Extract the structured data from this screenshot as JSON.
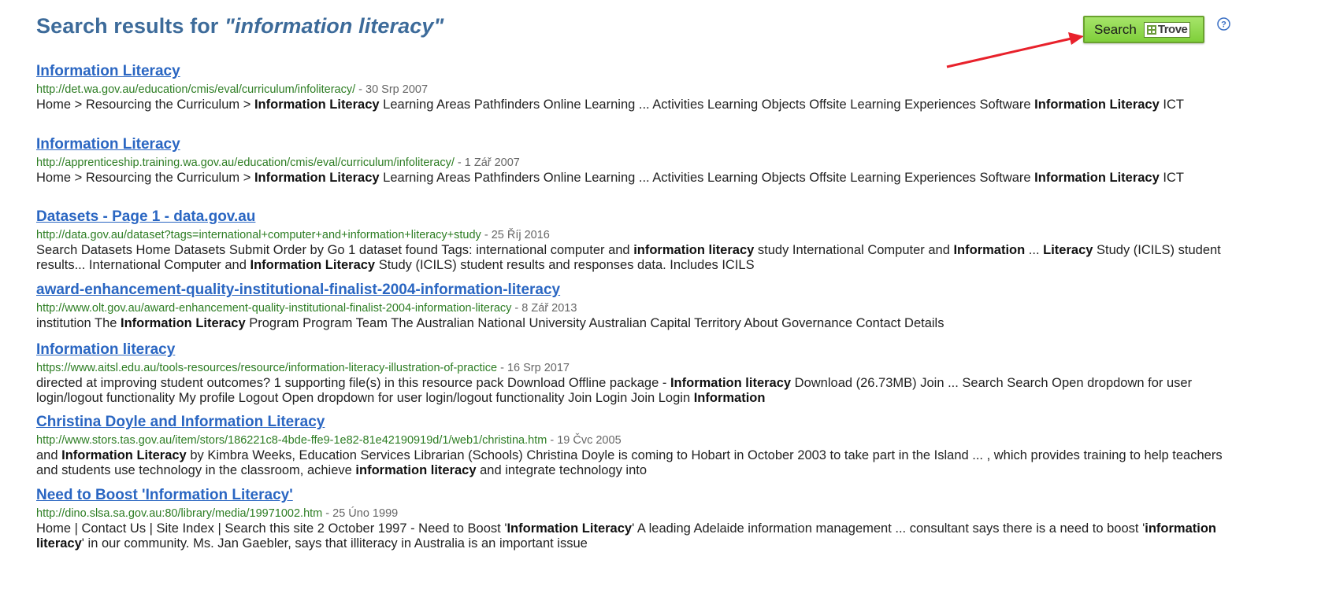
{
  "header": {
    "prefix": "Search results for ",
    "query": "\"information literacy\""
  },
  "trove_button": {
    "label": "Search",
    "logo_text": "Trove"
  },
  "help_icon": "question-circle-icon",
  "colors": {
    "title_blue": "#3d6b9a",
    "link_blue": "#2a66c2",
    "url_green": "#2d7d23",
    "button_green": "#8fd94a",
    "arrow_red": "#e8212b"
  },
  "results": [
    {
      "title": "Information Literacy",
      "url": "http://det.wa.gov.au/education/cmis/eval/curriculum/infoliteracy/",
      "date": " - 30 Srp 2007",
      "snippet": [
        {
          "t": "Home > Resourcing the Curriculum > ",
          "b": false
        },
        {
          "t": "Information Literacy",
          "b": true
        },
        {
          "t": " Learning Areas Pathfinders Online Learning ... Activities Learning Objects Offsite Learning Experiences Software ",
          "b": false
        },
        {
          "t": "Information Literacy",
          "b": true
        },
        {
          "t": " ICT",
          "b": false
        }
      ]
    },
    {
      "title": "Information Literacy",
      "url": "http://apprenticeship.training.wa.gov.au/education/cmis/eval/curriculum/infoliteracy/",
      "date": " - 1 Zář 2007",
      "snippet": [
        {
          "t": "Home > Resourcing the Curriculum > ",
          "b": false
        },
        {
          "t": "Information Literacy",
          "b": true
        },
        {
          "t": " Learning Areas Pathfinders Online Learning ... Activities Learning Objects Offsite Learning Experiences Software ",
          "b": false
        },
        {
          "t": "Information Literacy",
          "b": true
        },
        {
          "t": " ICT",
          "b": false
        }
      ]
    },
    {
      "title": "Datasets - Page 1 - data.gov.au",
      "url": "http://data.gov.au/dataset?tags=international+computer+and+information+literacy+study",
      "date": " - 25 Říj 2016",
      "snippet": [
        {
          "t": "Search Datasets Home Datasets Submit Order by Go 1 dataset found Tags: international computer and ",
          "b": false
        },
        {
          "t": "information literacy",
          "b": true
        },
        {
          "t": " study International Computer and ",
          "b": false
        },
        {
          "t": "Information",
          "b": true
        },
        {
          "t": " ... ",
          "b": false
        },
        {
          "t": "Literacy",
          "b": true
        },
        {
          "t": " Study (ICILS) student results... International Computer and ",
          "b": false
        },
        {
          "t": "Information Literacy",
          "b": true
        },
        {
          "t": " Study (ICILS) student results and responses data. Includes ICILS",
          "b": false
        }
      ]
    },
    {
      "title": "award-enhancement-quality-institutional-finalist-2004-information-literacy",
      "url": "http://www.olt.gov.au/award-enhancement-quality-institutional-finalist-2004-information-literacy",
      "date": " - 8 Zář 2013",
      "snippet": [
        {
          "t": "institution The ",
          "b": false
        },
        {
          "t": "Information Literacy",
          "b": true
        },
        {
          "t": " Program Program Team The Australian National University Australian Capital Territory About Governance Contact Details",
          "b": false
        }
      ]
    },
    {
      "title": "Information literacy",
      "url": "https://www.aitsl.edu.au/tools-resources/resource/information-literacy-illustration-of-practice",
      "date": " - 16 Srp 2017",
      "snippet": [
        {
          "t": "directed at improving student outcomes? 1 supporting file(s) in this resource pack Download Offline package - ",
          "b": false
        },
        {
          "t": "Information literacy",
          "b": true
        },
        {
          "t": " Download (26.73MB) Join ... Search Search Open dropdown for user login/logout functionality My profile Logout Open dropdown for user login/logout functionality Join Login Join Login ",
          "b": false
        },
        {
          "t": "Information",
          "b": true
        }
      ]
    },
    {
      "title": "Christina Doyle and Information Literacy",
      "url": "http://www.stors.tas.gov.au/item/stors/186221c8-4bde-ffe9-1e82-81e42190919d/1/web1/christina.htm",
      "date": " - 19 Čvc 2005",
      "snippet": [
        {
          "t": "and ",
          "b": false
        },
        {
          "t": "Information Literacy",
          "b": true
        },
        {
          "t": " by Kimbra Weeks, Education Services Librarian (Schools) Christina Doyle is coming to Hobart in October 2003 to take part in the Island ... , which provides training to help teachers and students use technology in the classroom, achieve ",
          "b": false
        },
        {
          "t": "information literacy",
          "b": true
        },
        {
          "t": " and integrate technology into",
          "b": false
        }
      ]
    },
    {
      "title": "Need to Boost 'Information Literacy'",
      "url": "http://dino.slsa.sa.gov.au:80/library/media/19971002.htm",
      "date": " - 25 Úno 1999",
      "snippet": [
        {
          "t": "Home | Contact Us | Site Index | Search this site 2 October 1997 - Need to Boost '",
          "b": false
        },
        {
          "t": "Information Literacy",
          "b": true
        },
        {
          "t": "' A leading Adelaide information management ... consultant says there is a need to boost '",
          "b": false
        },
        {
          "t": "information literacy",
          "b": true
        },
        {
          "t": "' in our community. Ms. Jan Gaebler, says that illiteracy in Australia is an important issue",
          "b": false
        }
      ]
    }
  ]
}
